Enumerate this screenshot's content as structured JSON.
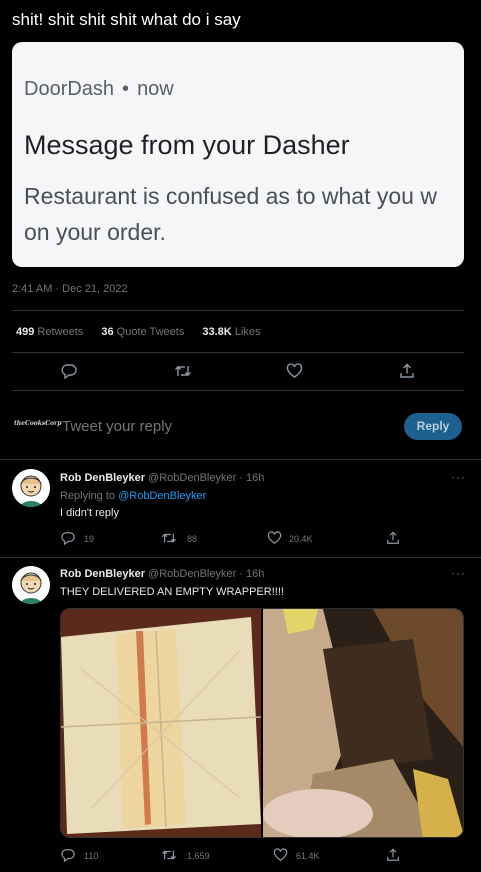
{
  "tweet": {
    "text": "shit! shit shit shit what do i say",
    "notification": {
      "app": "DoorDash",
      "dot": "•",
      "time": "now",
      "title": "Message from your Dasher",
      "body_line1": "Restaurant is confused as to what you w",
      "body_line2": "on your order."
    },
    "timestamp": "2:41 AM · Dec 21, 2022",
    "stats": {
      "retweets_count": "499",
      "retweets_label": "Retweets",
      "quotes_count": "36",
      "quotes_label": "Quote Tweets",
      "likes_count": "33.8K",
      "likes_label": "Likes"
    }
  },
  "reply_box": {
    "avatar_text": "theCooksCorp",
    "placeholder": "Tweet your reply",
    "button_label": "Reply"
  },
  "replies": [
    {
      "name": "Rob DenBleyker",
      "handle": "@RobDenBleyker · 16h",
      "replying_prefix": "Replying to",
      "replying_to": "@RobDenBleyker",
      "text": "I didn't reply",
      "reply_count": "19",
      "retweet_count": "88",
      "like_count": "20.4K",
      "more": "···"
    },
    {
      "name": "Rob DenBleyker",
      "handle": "@RobDenBleyker · 16h",
      "text": "THEY DELIVERED AN EMPTY WRAPPER!!!!",
      "reply_count": "110",
      "retweet_count": "1,659",
      "like_count": "61.4K",
      "more": "···"
    }
  ],
  "icons": {
    "reply": "reply-icon",
    "retweet": "retweet-icon",
    "like": "heart-icon",
    "share": "share-icon"
  },
  "colors": {
    "background": "#000000",
    "accent": "#1d9bf0",
    "reply_button": "#1d5f8f"
  }
}
